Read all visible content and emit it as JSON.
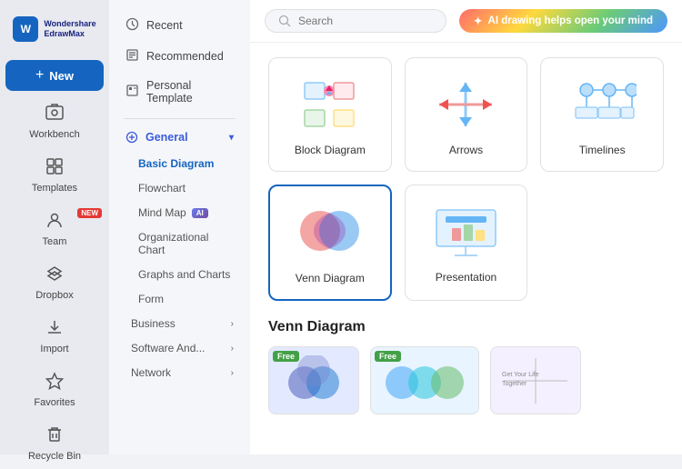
{
  "app": {
    "name": "Wondershare",
    "name2": "EdrawMax"
  },
  "sidebar": {
    "items": [
      {
        "id": "new",
        "label": "New",
        "icon": "☁"
      },
      {
        "id": "workbench",
        "label": "Workbench",
        "icon": "💼"
      },
      {
        "id": "templates",
        "label": "Templates",
        "icon": "📄"
      },
      {
        "id": "team",
        "label": "Team",
        "icon": "👤",
        "badge": "NEW"
      },
      {
        "id": "dropbox",
        "label": "Dropbox",
        "icon": "📦"
      },
      {
        "id": "import",
        "label": "Import",
        "icon": "⬇"
      },
      {
        "id": "favorites",
        "label": "Favorites",
        "icon": "⭐"
      },
      {
        "id": "recycle",
        "label": "Recycle Bin",
        "icon": "🗑"
      }
    ]
  },
  "middle_nav": {
    "items": [
      {
        "id": "recent",
        "label": "Recent",
        "icon": "🕐"
      },
      {
        "id": "recommended",
        "label": "Recommended",
        "icon": "📋"
      },
      {
        "id": "personal",
        "label": "Personal Template",
        "icon": "📄"
      }
    ],
    "categories": [
      {
        "id": "general",
        "label": "General",
        "expanded": true,
        "sub_items": [
          {
            "id": "basic",
            "label": "Basic Diagram",
            "active": true
          },
          {
            "id": "flowchart",
            "label": "Flowchart"
          },
          {
            "id": "mindmap",
            "label": "Mind Map",
            "badge": "AI"
          },
          {
            "id": "org",
            "label": "Organizational Chart"
          },
          {
            "id": "graphs",
            "label": "Graphs and Charts"
          },
          {
            "id": "form",
            "label": "Form"
          }
        ]
      },
      {
        "id": "business",
        "label": "Business",
        "has_arrow": true
      },
      {
        "id": "software",
        "label": "Software And...",
        "has_arrow": true
      },
      {
        "id": "network",
        "label": "Network",
        "has_arrow": true
      }
    ]
  },
  "top_bar": {
    "search": {
      "placeholder": "Search"
    },
    "ai_banner": "AI drawing helps open your mind"
  },
  "diagram_cards": [
    {
      "id": "block",
      "label": "Block Diagram"
    },
    {
      "id": "arrows",
      "label": "Arrows"
    },
    {
      "id": "timelines",
      "label": "Timelines"
    },
    {
      "id": "venn",
      "label": "Venn Diagram",
      "selected": true
    },
    {
      "id": "presentation",
      "label": "Presentation"
    }
  ],
  "section": {
    "title": "Venn Diagram",
    "templates": [
      {
        "id": "t1",
        "free": true,
        "bg": "#e3eaff"
      },
      {
        "id": "t2",
        "free": true,
        "bg": "#e3f0ff"
      },
      {
        "id": "t3",
        "free": false,
        "bg": "#f0f4ff"
      }
    ]
  },
  "colors": {
    "accent": "#1565c0",
    "sidebar_bg": "#e8eaf0",
    "free_badge": "#43a047"
  }
}
